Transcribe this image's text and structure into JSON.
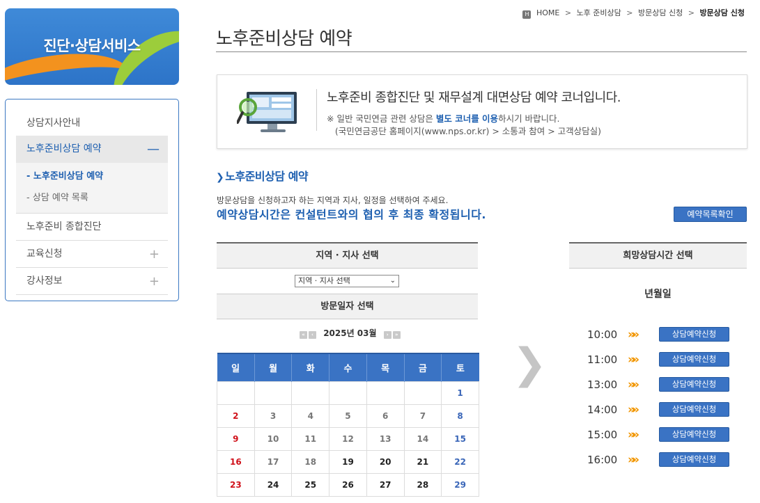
{
  "brand": {
    "title": "진단·상담서비스"
  },
  "sidebar": {
    "items": [
      {
        "label": "상담지사안내",
        "mark": ""
      },
      {
        "label": "노후준비상담 예약",
        "mark": "—"
      },
      {
        "label": "노후준비 종합진단",
        "mark": ""
      },
      {
        "label": "교육신청",
        "mark": "+"
      },
      {
        "label": "강사정보",
        "mark": "+"
      }
    ],
    "sub_items": [
      {
        "label": "- 노후준비상담 예약"
      },
      {
        "label": "- 상담 예약 목록"
      }
    ]
  },
  "breadcrumb": {
    "home_icon": "H",
    "home": "HOME",
    "sep": ">",
    "level1": "노후 준비상담",
    "level2": "방문상담 신청",
    "current": "방문상담 신청"
  },
  "page": {
    "title": "노후준비상담 예약"
  },
  "info": {
    "heading": "노후준비 종합진단 및 재무설계 대면상담 예약 코너입니다.",
    "note_prefix": "※ 일반 국민연금 관련 상담은 ",
    "note_highlight": "별도 코너를 이용",
    "note_suffix": "하시기 바랍니다.",
    "note_line2": "(국민연금공단 홈페이지(www.nps.or.kr) > 소통과 참여 > 고객상담실)"
  },
  "section": {
    "title": "노후준비상담 예약",
    "desc": "방문상담을 신청하고자 하는 지역과 지사, 일정을 선택하여 주세요.",
    "highlight": "예약상담시간은 컨설턴트와의 협의 후 최종 확정됩니다.",
    "list_button": "예약목록확인"
  },
  "region": {
    "header": "지역 · 지사 선택",
    "select_value": "지역 · 지사 선택"
  },
  "calendar": {
    "header": "방문일자 선택",
    "month_label": "2025년 03월",
    "nav_first": "«",
    "nav_prev": "‹",
    "nav_next": "›",
    "nav_last": "»",
    "weekdays": [
      "일",
      "월",
      "화",
      "수",
      "목",
      "금",
      "토"
    ],
    "weeks": [
      [
        "",
        "",
        "",
        "",
        "",
        "",
        "1"
      ],
      [
        "2",
        "3",
        "4",
        "5",
        "6",
        "7",
        "8"
      ],
      [
        "9",
        "10",
        "11",
        "12",
        "13",
        "14",
        "15"
      ],
      [
        "16",
        "17",
        "18",
        "19",
        "20",
        "21",
        "22"
      ],
      [
        "23",
        "24",
        "25",
        "26",
        "27",
        "28",
        "29"
      ]
    ]
  },
  "divider_arrow": "❯",
  "time": {
    "header": "희망상담시간 선택",
    "date_label": "년월일",
    "slots": [
      {
        "time": "10:00",
        "chevron": "»»",
        "button": "상담예약신청"
      },
      {
        "time": "11:00",
        "chevron": "»»",
        "button": "상담예약신청"
      },
      {
        "time": "13:00",
        "chevron": "»»",
        "button": "상담예약신청"
      },
      {
        "time": "14:00",
        "chevron": "»»",
        "button": "상담예약신청"
      },
      {
        "time": "15:00",
        "chevron": "»»",
        "button": "상담예약신청"
      },
      {
        "time": "16:00",
        "chevron": "»»",
        "button": "상담예약신청"
      }
    ]
  }
}
